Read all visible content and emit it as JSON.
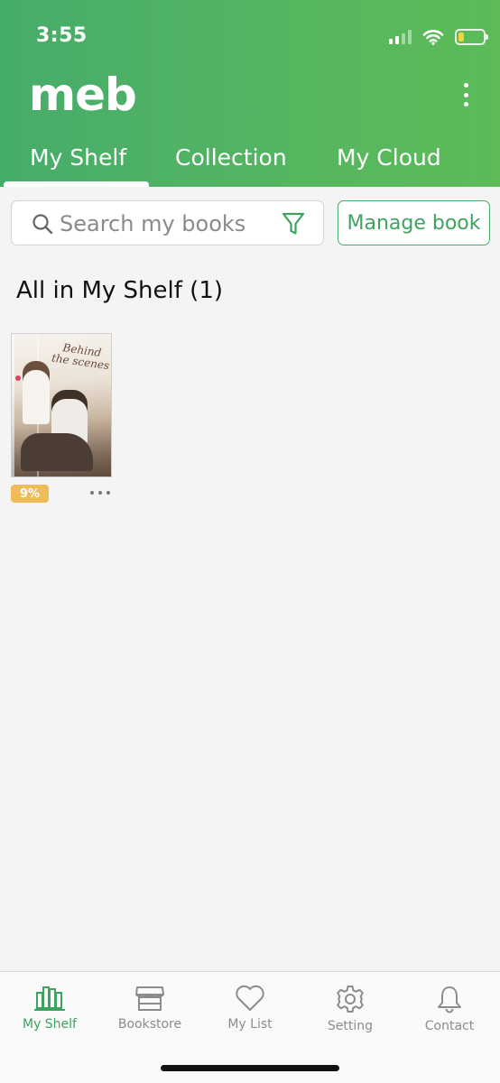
{
  "status_bar": {
    "time": "3:55",
    "battery_color": "#f3d43a"
  },
  "header": {
    "logo": "meb",
    "more_icon": "vertical-ellipsis-icon",
    "background_color": "#55b660",
    "tabs": [
      {
        "label": "My Shelf",
        "active": true
      },
      {
        "label": "Collection",
        "active": false
      },
      {
        "label": "My Cloud",
        "active": false
      }
    ]
  },
  "search": {
    "placeholder": "Search my books",
    "value": "",
    "search_icon": "search-icon",
    "filter_icon": "filter-icon"
  },
  "manage_button_label": "Manage book",
  "section_title": "All in My Shelf (1)",
  "books": [
    {
      "cover_title": "Behind the scenes",
      "progress": "9%",
      "progress_color": "#eebd58"
    }
  ],
  "bottom_nav": {
    "accent_color": "#3ea35f",
    "items": [
      {
        "label": "My Shelf",
        "icon": "bookshelf-icon",
        "active": true
      },
      {
        "label": "Bookstore",
        "icon": "store-icon",
        "active": false
      },
      {
        "label": "My List",
        "icon": "heart-icon",
        "active": false
      },
      {
        "label": "Setting",
        "icon": "gear-icon",
        "active": false
      },
      {
        "label": "Contact",
        "icon": "bell-icon",
        "active": false
      }
    ]
  }
}
